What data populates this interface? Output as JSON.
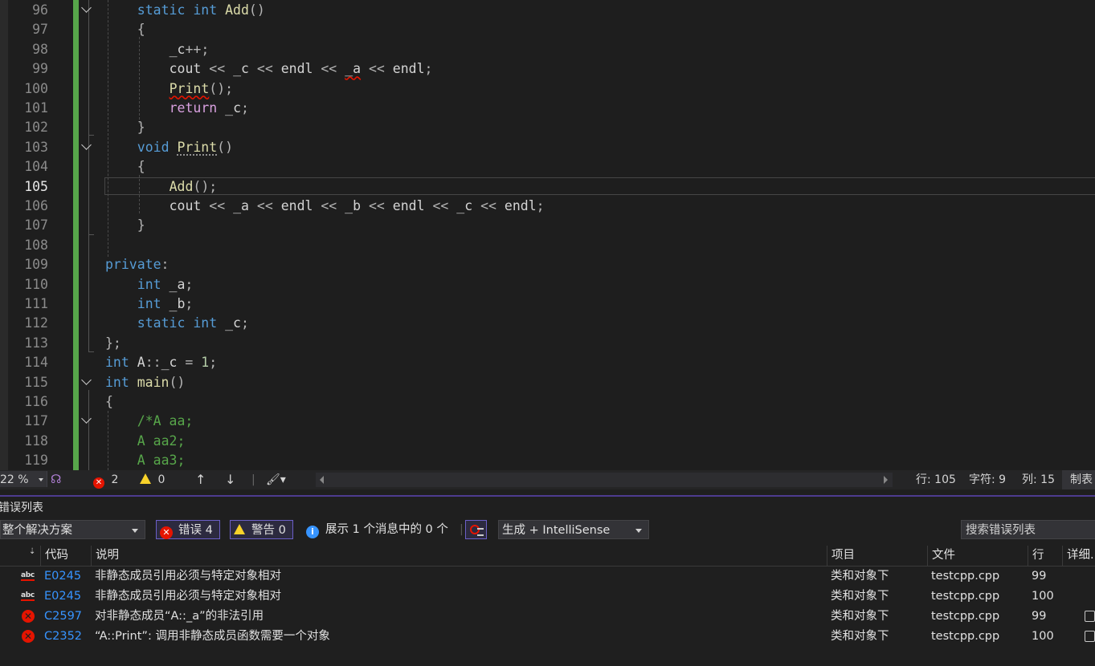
{
  "editor": {
    "lines": [
      {
        "n": "96",
        "indent": 1,
        "fold": true,
        "tokens": [
          [
            "kw",
            "static"
          ],
          [
            "t",
            " "
          ],
          [
            "kw",
            "int"
          ],
          [
            "t",
            " "
          ],
          [
            "fn",
            "Add"
          ],
          [
            "op",
            "()"
          ]
        ]
      },
      {
        "n": "97",
        "indent": 1,
        "tokens": [
          [
            "op",
            "{"
          ]
        ]
      },
      {
        "n": "98",
        "indent": 2,
        "tokens": [
          [
            "t",
            "_c"
          ],
          [
            "op",
            "++;"
          ]
        ]
      },
      {
        "n": "99",
        "indent": 2,
        "tokens": [
          [
            "t",
            "cout "
          ],
          [
            "op",
            "<<"
          ],
          [
            "t",
            " _c "
          ],
          [
            "op",
            "<<"
          ],
          [
            "t",
            " endl "
          ],
          [
            "op",
            "<<"
          ],
          [
            "t",
            " "
          ],
          [
            "sq",
            "_a"
          ],
          [
            "t",
            " "
          ],
          [
            "op",
            "<<"
          ],
          [
            "t",
            " endl"
          ],
          [
            "op",
            ";"
          ]
        ]
      },
      {
        "n": "100",
        "indent": 2,
        "tokens": [
          [
            "fnsq",
            "Print"
          ],
          [
            "op",
            "();"
          ]
        ]
      },
      {
        "n": "101",
        "indent": 2,
        "tokens": [
          [
            "pp",
            "return"
          ],
          [
            "t",
            " _c"
          ],
          [
            "op",
            ";"
          ]
        ]
      },
      {
        "n": "102",
        "indent": 1,
        "tokens": [
          [
            "op",
            "}"
          ]
        ]
      },
      {
        "n": "103",
        "indent": 1,
        "fold": true,
        "tokens": [
          [
            "kw",
            "void"
          ],
          [
            "t",
            " "
          ],
          [
            "fndot",
            "Print"
          ],
          [
            "op",
            "()"
          ]
        ]
      },
      {
        "n": "104",
        "indent": 1,
        "tokens": [
          [
            "op",
            "{"
          ]
        ]
      },
      {
        "n": "105",
        "indent": 2,
        "current": true,
        "tokens": [
          [
            "fn",
            "Add"
          ],
          [
            "op",
            "();"
          ]
        ]
      },
      {
        "n": "106",
        "indent": 2,
        "tokens": [
          [
            "t",
            "cout "
          ],
          [
            "op",
            "<<"
          ],
          [
            "t",
            " _a "
          ],
          [
            "op",
            "<<"
          ],
          [
            "t",
            " endl "
          ],
          [
            "op",
            "<<"
          ],
          [
            "t",
            " _b "
          ],
          [
            "op",
            "<<"
          ],
          [
            "t",
            " endl "
          ],
          [
            "op",
            "<<"
          ],
          [
            "t",
            " _c "
          ],
          [
            "op",
            "<<"
          ],
          [
            "t",
            " endl"
          ],
          [
            "op",
            ";"
          ]
        ]
      },
      {
        "n": "107",
        "indent": 1,
        "tokens": [
          [
            "op",
            "}"
          ]
        ]
      },
      {
        "n": "108",
        "indent": 0,
        "tokens": []
      },
      {
        "n": "109",
        "indent": 0,
        "tokens": [
          [
            "kw",
            "private"
          ],
          [
            "op",
            ":"
          ]
        ]
      },
      {
        "n": "110",
        "indent": 1,
        "tokens": [
          [
            "kw",
            "int"
          ],
          [
            "t",
            " _a"
          ],
          [
            "op",
            ";"
          ]
        ]
      },
      {
        "n": "111",
        "indent": 1,
        "tokens": [
          [
            "kw",
            "int"
          ],
          [
            "t",
            " _b"
          ],
          [
            "op",
            ";"
          ]
        ]
      },
      {
        "n": "112",
        "indent": 1,
        "tokens": [
          [
            "kw",
            "static"
          ],
          [
            "t",
            " "
          ],
          [
            "kw",
            "int"
          ],
          [
            "t",
            " _c"
          ],
          [
            "op",
            ";"
          ]
        ]
      },
      {
        "n": "113",
        "indent": 0,
        "tokens": [
          [
            "op",
            "};"
          ]
        ]
      },
      {
        "n": "114",
        "indent": 0,
        "tokens": [
          [
            "kw",
            "int"
          ],
          [
            "t",
            " A"
          ],
          [
            "op",
            "::"
          ],
          [
            "t",
            "_c "
          ],
          [
            "op",
            "="
          ],
          [
            "t",
            " "
          ],
          [
            "num",
            "1"
          ],
          [
            "op",
            ";"
          ]
        ]
      },
      {
        "n": "115",
        "indent": 0,
        "fold": true,
        "tokens": [
          [
            "kw",
            "int"
          ],
          [
            "t",
            " "
          ],
          [
            "fn",
            "main"
          ],
          [
            "op",
            "()"
          ]
        ]
      },
      {
        "n": "116",
        "indent": 0,
        "tokens": [
          [
            "op",
            "{"
          ]
        ]
      },
      {
        "n": "117",
        "indent": 1,
        "fold": true,
        "tokens": [
          [
            "cm",
            "/*A aa;"
          ]
        ]
      },
      {
        "n": "118",
        "indent": 1,
        "tokens": [
          [
            "cm",
            "A aa2;"
          ]
        ]
      },
      {
        "n": "119",
        "indent": 1,
        "tokens": [
          [
            "cm",
            "A aa3;"
          ]
        ]
      }
    ]
  },
  "status": {
    "zoom": "22 %",
    "errors": "2",
    "warnings": "0",
    "line": "行: 105",
    "char": "字符: 9",
    "col": "列: 15",
    "tab": "制表"
  },
  "errorlist": {
    "title": "错误列表",
    "scope": "整个解决方案",
    "errors_btn": "错误 4",
    "warnings_btn": "警告 0",
    "messages": "展示 1 个消息中的 0 个",
    "build_filter": "生成 + IntelliSense",
    "search_placeholder": "搜索错误列表",
    "headers": {
      "code": "代码",
      "desc": "说明",
      "project": "项目",
      "file": "文件",
      "line": "行",
      "detail": "详细."
    },
    "rows": [
      {
        "icon": "spell-error-icon",
        "code": "E0245",
        "desc": "非静态成员引用必须与特定对象相对",
        "project": "类和对象下",
        "file": "testcpp.cpp",
        "line": "99",
        "copy": false
      },
      {
        "icon": "spell-error-icon",
        "code": "E0245",
        "desc": "非静态成员引用必须与特定对象相对",
        "project": "类和对象下",
        "file": "testcpp.cpp",
        "line": "100",
        "copy": false
      },
      {
        "icon": "error-icon",
        "code": "C2597",
        "desc": "对非静态成员“A::_a”的非法引用",
        "project": "类和对象下",
        "file": "testcpp.cpp",
        "line": "99",
        "copy": true
      },
      {
        "icon": "error-icon",
        "code": "C2352",
        "desc": "“A::Print”: 调用非静态成员函数需要一个对象",
        "project": "类和对象下",
        "file": "testcpp.cpp",
        "line": "100",
        "copy": true
      }
    ]
  }
}
